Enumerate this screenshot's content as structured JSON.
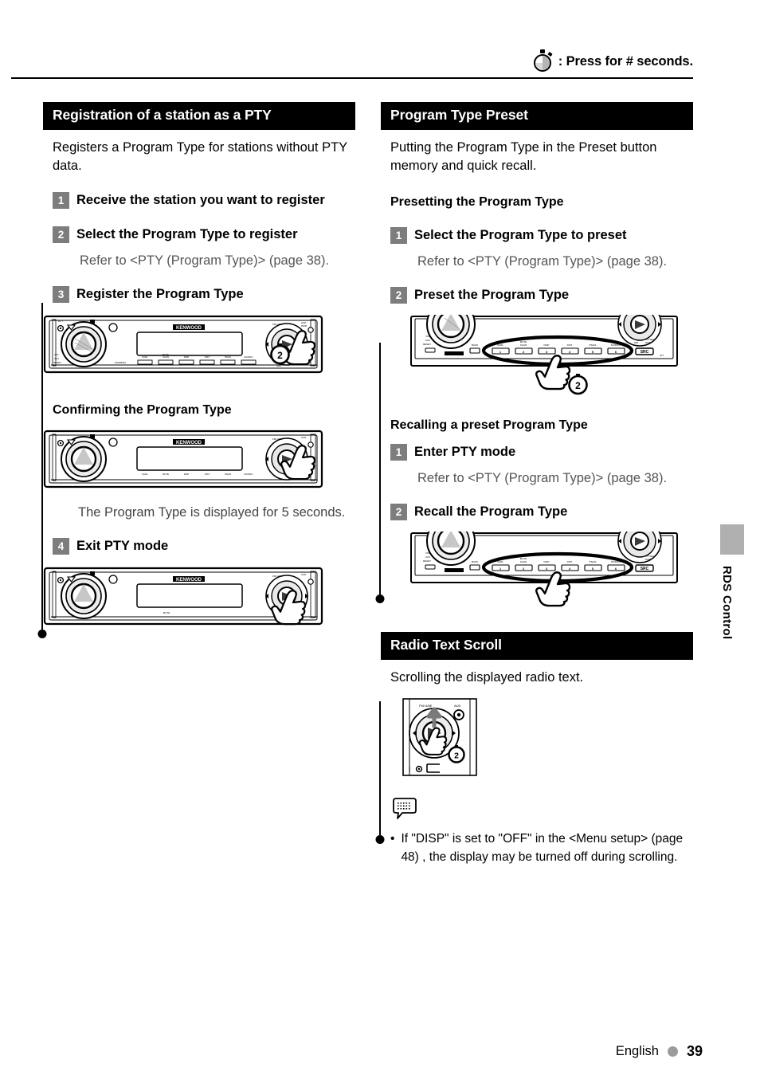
{
  "header": {
    "icon": "stopwatch-icon",
    "legend": ": Press for # seconds."
  },
  "left_column": {
    "section_title": "Registration of a station as a PTY",
    "intro": "Registers a Program Type for stations without PTY data.",
    "steps": [
      {
        "num": "1",
        "label": "Receive the station you want to register"
      },
      {
        "num": "2",
        "label": "Select the Program Type to register",
        "note": "Refer to <PTY (Program Type)> (page 38)."
      },
      {
        "num": "3",
        "label": "Register the Program Type"
      }
    ],
    "subhead_confirming": "Confirming the Program Type",
    "confirm_note": "The Program Type is displayed for 5 seconds.",
    "step4": {
      "num": "4",
      "label": "Exit PTY mode"
    }
  },
  "right_column": {
    "section_title": "Program Type Preset",
    "intro": "Putting the Program Type in the Preset button memory and quick recall.",
    "subhead_presetting": "Presetting the Program Type",
    "preset_steps": [
      {
        "num": "1",
        "label": "Select the Program Type to preset",
        "note": "Refer to <PTY (Program Type)> (page 38)."
      },
      {
        "num": "2",
        "label": "Preset the Program Type"
      }
    ],
    "subhead_recalling": "Recalling a preset Program Type",
    "recall_steps": [
      {
        "num": "1",
        "label": "Enter PTY mode",
        "note": "Refer to <PTY (Program Type)> (page 38)."
      },
      {
        "num": "2",
        "label": "Recall the Program Type"
      }
    ],
    "radio_text": {
      "section_title": "Radio Text Scroll",
      "intro": "Scrolling the displayed radio text.",
      "note_icon": "note-bubble-icon",
      "note_bullet_marker": "•",
      "note_text": "If \"DISP\" is set to \"OFF\" in the <Menu setup> (page 48) , the display may be turned off during scrolling."
    }
  },
  "side_tab": {
    "label": "RDS Control"
  },
  "footer": {
    "language": "English",
    "page_number": "39"
  },
  "device": {
    "brand": "KENWOOD",
    "badge_number": "2",
    "src_button": "SRC"
  },
  "colors": {
    "section_bar_bg": "#000000",
    "step_badge_bg": "#7d7d7d",
    "side_tab_bg": "#b0b0b0",
    "footer_dot": "#9b9b9b"
  }
}
